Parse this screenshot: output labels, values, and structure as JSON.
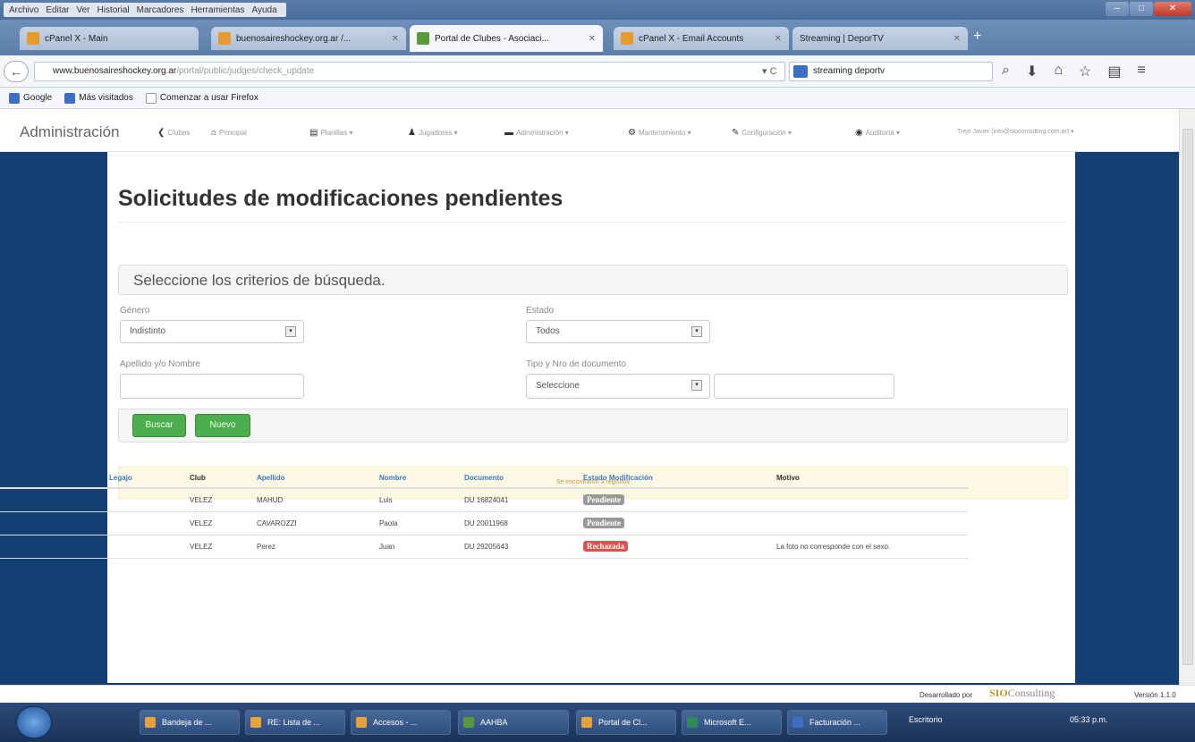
{
  "browser": {
    "menu": [
      "Archivo",
      "Editar",
      "Ver",
      "Historial",
      "Marcadores",
      "Herramientas",
      "Ayuda"
    ],
    "tabs": [
      {
        "label": "cPanel X - Main"
      },
      {
        "label": "buenosaireshockey.org.ar /..."
      },
      {
        "label": "Portal de Clubes - Asociaci..."
      },
      {
        "label": "cPanel X - Email Accounts"
      },
      {
        "label": "Streaming | DeporTV"
      }
    ],
    "url_domain": "www.buenosaireshockey.org.ar",
    "url_path": "/portal/public/judges/check_update",
    "search_value": "streaming deportv",
    "bookmarks": [
      "Google",
      "Más visitados",
      "Comenzar a usar Firefox"
    ]
  },
  "app": {
    "brand": "Administración",
    "nav": [
      {
        "label": "Clubes",
        "icon": "chevron-left-icon"
      },
      {
        "label": "Principal",
        "icon": "home-icon"
      },
      {
        "label": "Planillas",
        "icon": "list-icon"
      },
      {
        "label": "Jugadores",
        "icon": "user-icon"
      },
      {
        "label": "Administración",
        "icon": "building-icon"
      },
      {
        "label": "Mantenimiento",
        "icon": "gear-icon"
      },
      {
        "label": "Configuración",
        "icon": "wrench-icon"
      },
      {
        "label": "Auditoría",
        "icon": "globe-icon"
      },
      {
        "label": "Trejo Javier (info@sioconsulting.com.ar)"
      }
    ]
  },
  "main": {
    "title": "Solicitudes de modificaciones pendientes",
    "search_panel_title": "Seleccione los criterios de búsqueda.",
    "fields": {
      "genero_label": "Género",
      "genero_value": "Indistinto",
      "estado_label": "Estado",
      "estado_value": "Todos",
      "nombre_label": "Apellido y/o Nombre",
      "doc_label": "Tipo y Nro de documento",
      "doc_value": "Seleccione"
    },
    "buttons": {
      "search": "Buscar",
      "new": "Nuevo"
    },
    "alert": "Se encontraron 3 registros",
    "table": {
      "headers": [
        "Legajo",
        "Club",
        "Apellido",
        "Nombre",
        "Documento",
        "Estado Modificación",
        "Motivo"
      ],
      "rows": [
        {
          "legajo": "",
          "club": "VELEZ",
          "apellido": "MAHUD",
          "nombre": "Luis",
          "documento": "DU 16824041",
          "estado": "Pendiente",
          "motivo": ""
        },
        {
          "legajo": "",
          "club": "VELEZ",
          "apellido": "CAVAROZZI",
          "nombre": "Paola",
          "documento": "DU 20011968",
          "estado": "Pendiente",
          "motivo": ""
        },
        {
          "legajo": "",
          "club": "VELEZ",
          "apellido": "Perez",
          "nombre": "Juan",
          "documento": "DU 29205643",
          "estado": "Rechazada",
          "motivo": "La foto no corresponde con el sexo."
        }
      ]
    }
  },
  "footer": {
    "developed_by": "Desarrollado por",
    "company": "SIO",
    "company_rest": "Consulting",
    "version": "Versión 1.1.0"
  },
  "taskbar": {
    "items": [
      "Bandeja de ...",
      "RE: Lista de ...",
      "Accesos - ...",
      "AAHBA",
      "Portal de Cl...",
      "Microsoft E...",
      "Facturación ..."
    ],
    "tray": "Escritorio",
    "clock": "05:33 p.m."
  },
  "colors": {
    "page_bg": "#133f72",
    "success": "#4cae4c",
    "danger": "#d9534f",
    "link": "#3a7cc4"
  }
}
